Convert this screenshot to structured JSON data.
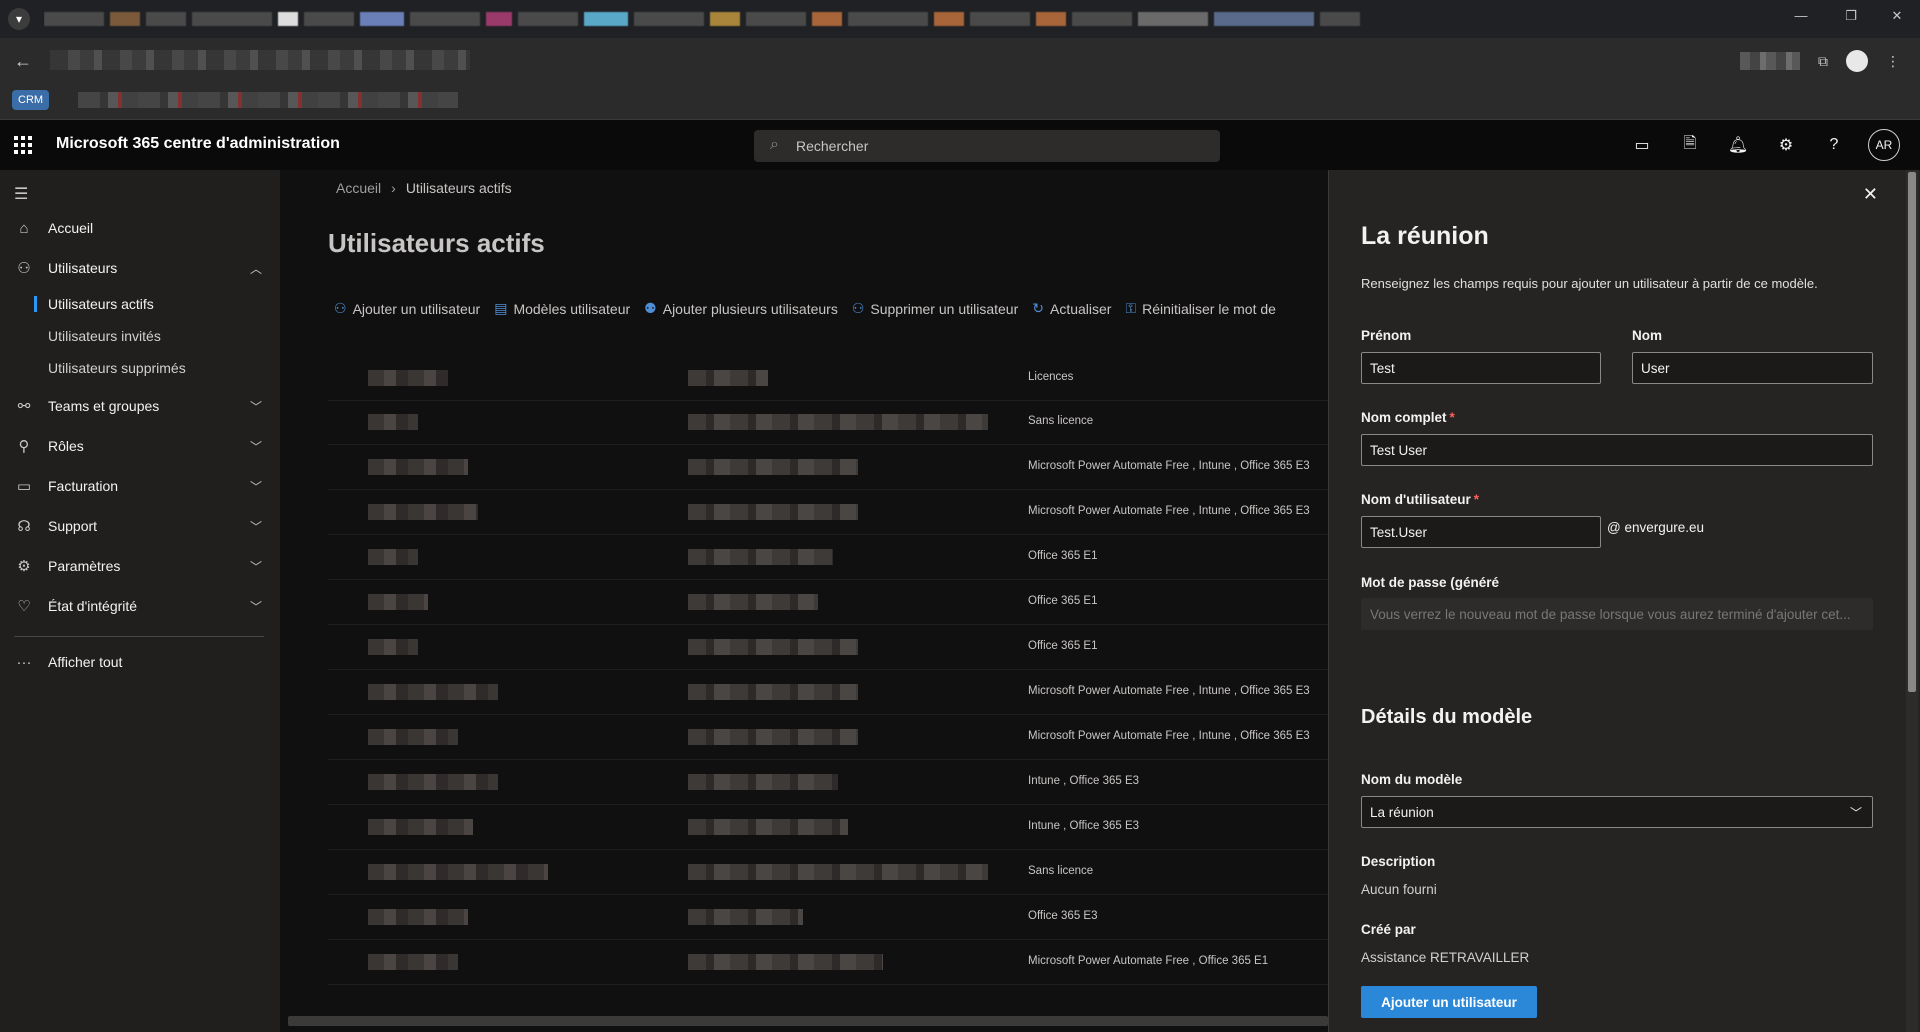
{
  "browser": {
    "bookmark_tag": "CRM"
  },
  "header": {
    "app_title": "Microsoft 365 centre d'administration",
    "search_placeholder": "Rechercher",
    "avatar_initials": "AR"
  },
  "sidebar": {
    "items": [
      {
        "label": "Accueil",
        "icon": "home-icon"
      },
      {
        "label": "Utilisateurs",
        "icon": "user-icon"
      },
      {
        "label": "Teams et groupes",
        "icon": "teams-icon"
      },
      {
        "label": "Rôles",
        "icon": "roles-icon"
      },
      {
        "label": "Facturation",
        "icon": "billing-icon"
      },
      {
        "label": "Support",
        "icon": "headset-icon"
      },
      {
        "label": "Paramètres",
        "icon": "gear-icon"
      },
      {
        "label": "État d'intégrité",
        "icon": "health-icon"
      }
    ],
    "sub_items": [
      "Utilisateurs actifs",
      "Utilisateurs invités",
      "Utilisateurs supprimés"
    ],
    "show_all": "Afficher tout"
  },
  "main": {
    "breadcrumb": [
      "Accueil",
      "Utilisateurs actifs"
    ],
    "title": "Utilisateurs actifs",
    "commands": [
      "Ajouter un utilisateur",
      "Modèles utilisateur",
      "Ajouter plusieurs utilisateurs",
      "Supprimer un utilisateur",
      "Actualiser",
      "Réinitialiser le mot de"
    ],
    "licences_header": "Licences",
    "rows": [
      "Sans licence",
      "Microsoft Power Automate Free , Intune , Office 365 E3",
      "Microsoft Power Automate Free , Intune , Office 365 E3",
      "Office 365 E1",
      "Office 365 E1",
      "Office 365 E1",
      "Microsoft Power Automate Free , Intune , Office 365 E3",
      "Microsoft Power Automate Free , Intune , Office 365 E3",
      "Intune , Office 365 E3",
      "Intune , Office 365 E3",
      "Sans licence",
      "Office 365 E3",
      "Microsoft Power Automate Free , Office 365 E1"
    ]
  },
  "panel": {
    "title": "La réunion",
    "description": "Renseignez les champs requis pour ajouter un utilisateur à partir de ce modèle.",
    "first_name_label": "Prénom",
    "first_name_value": "Test",
    "last_name_label": "Nom",
    "last_name_value": "User",
    "full_name_label": "Nom complet",
    "full_name_value": "Test User",
    "username_label": "Nom d'utilisateur",
    "username_value": "Test.User",
    "domain": "@ envergure.eu",
    "password_label": "Mot de passe (généré",
    "password_placeholder": "Vous verrez le nouveau mot de passe lorsque vous aurez terminé d'ajouter cet...",
    "details_title": "Détails du modèle",
    "template_name_label": "Nom du modèle",
    "template_name_value": "La réunion",
    "description_label": "Description",
    "description_value": "Aucun fourni",
    "created_by_label": "Créé par",
    "created_by_value": "Assistance RETRAVAILLER",
    "add_button": "Ajouter un utilisateur"
  },
  "colors": {
    "accent": "#2b88d8",
    "required": "#ff5f5f"
  }
}
